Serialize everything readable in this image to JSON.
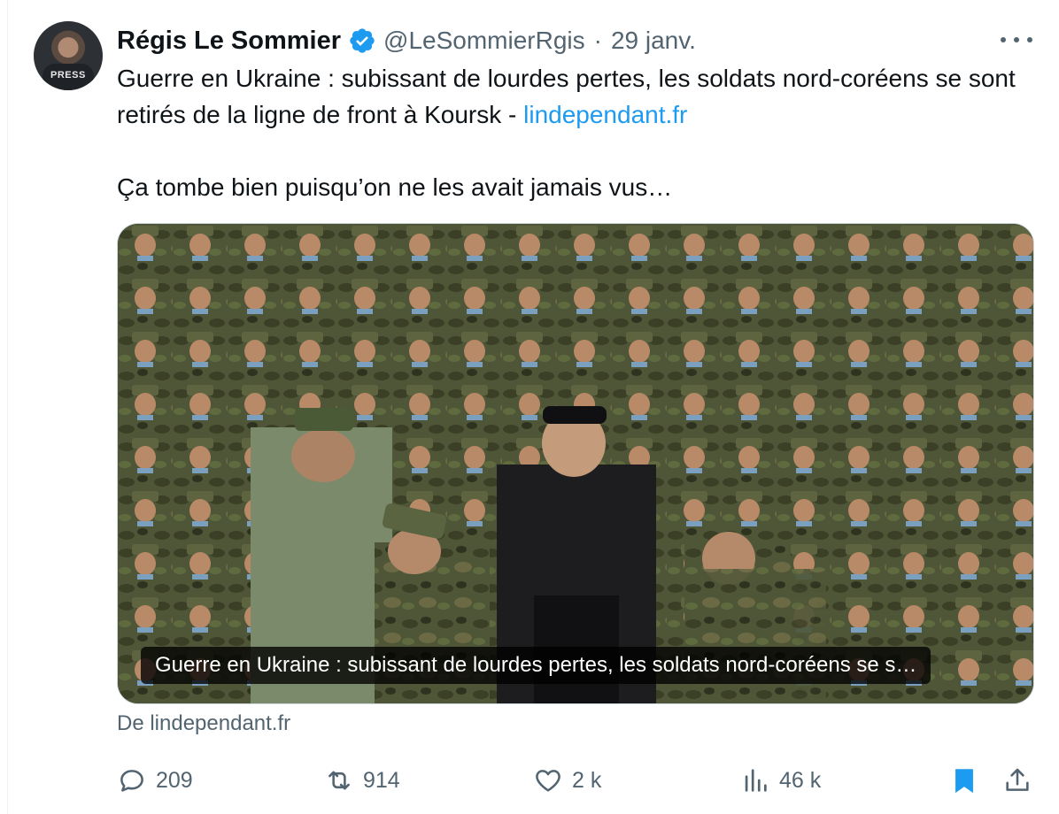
{
  "tweet": {
    "author": {
      "display_name": "Régis Le Sommier",
      "handle": "@LeSommierRgis",
      "verified": true,
      "avatar_text": "PRESS"
    },
    "separator": "·",
    "date": "29 janv.",
    "text_line1": "Guerre en Ukraine : subissant de lourdes pertes, les soldats nord-coréens se sont retirés de la ligne de front à Koursk - ",
    "link_text": "lindependant.fr",
    "text_line2": "Ça tombe bien puisqu’on ne les avait jamais vus…",
    "media": {
      "caption": "Guerre en Ukraine : subissant de lourdes pertes, les soldats nord-coréens se s…"
    },
    "source_label": "De lindependant.fr",
    "actions": {
      "replies": "209",
      "retweets": "914",
      "likes": "2 k",
      "views": "46 k"
    }
  },
  "colors": {
    "text": "#0f1419",
    "secondary": "#536471",
    "link": "#1d9bf0",
    "bookmark_active": "#1d9bf0",
    "border": "#cfd9de"
  }
}
